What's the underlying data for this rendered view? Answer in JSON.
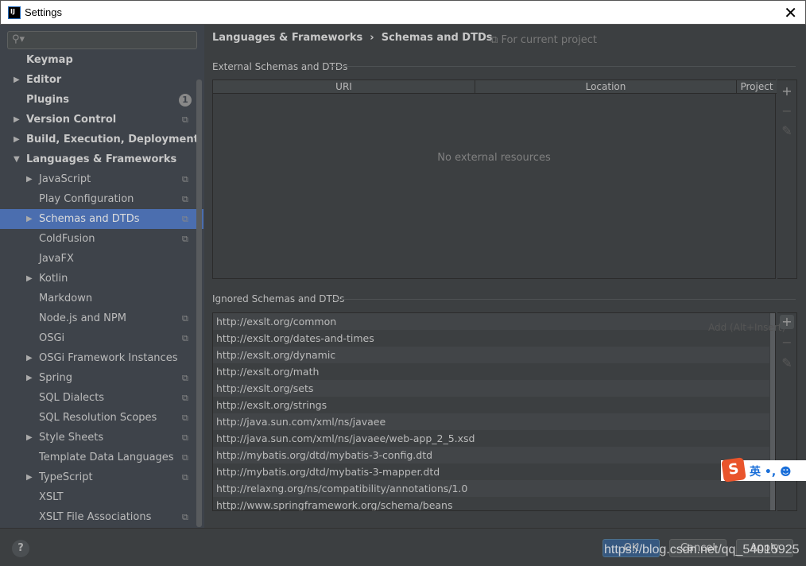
{
  "window": {
    "title": "Settings",
    "logo": "IJ"
  },
  "sidebar": {
    "search_placeholder": "",
    "items": [
      {
        "label": "Keymap",
        "level": 0,
        "bold": true,
        "arrow": false
      },
      {
        "label": "Editor",
        "level": 0,
        "bold": true,
        "arrow": "right"
      },
      {
        "label": "Plugins",
        "level": 0,
        "bold": true,
        "arrow": false,
        "badge": "1"
      },
      {
        "label": "Version Control",
        "level": 0,
        "bold": true,
        "arrow": "right",
        "copy": true
      },
      {
        "label": "Build, Execution, Deployment",
        "level": 0,
        "bold": true,
        "arrow": "right"
      },
      {
        "label": "Languages & Frameworks",
        "level": 0,
        "bold": true,
        "arrow": "down"
      },
      {
        "label": "JavaScript",
        "level": 1,
        "arrow": "right",
        "copy": true
      },
      {
        "label": "Play Configuration",
        "level": 1,
        "copy": true
      },
      {
        "label": "Schemas and DTDs",
        "level": 1,
        "arrow": "right",
        "copy": true,
        "selected": true
      },
      {
        "label": "ColdFusion",
        "level": 1,
        "copy": true
      },
      {
        "label": "JavaFX",
        "level": 1
      },
      {
        "label": "Kotlin",
        "level": 1,
        "arrow": "right"
      },
      {
        "label": "Markdown",
        "level": 1
      },
      {
        "label": "Node.js and NPM",
        "level": 1,
        "copy": true
      },
      {
        "label": "OSGi",
        "level": 1,
        "copy": true
      },
      {
        "label": "OSGi Framework Instances",
        "level": 1,
        "arrow": "right"
      },
      {
        "label": "Spring",
        "level": 1,
        "arrow": "right",
        "copy": true
      },
      {
        "label": "SQL Dialects",
        "level": 1,
        "copy": true
      },
      {
        "label": "SQL Resolution Scopes",
        "level": 1,
        "copy": true
      },
      {
        "label": "Style Sheets",
        "level": 1,
        "arrow": "right",
        "copy": true
      },
      {
        "label": "Template Data Languages",
        "level": 1,
        "copy": true
      },
      {
        "label": "TypeScript",
        "level": 1,
        "arrow": "right",
        "copy": true
      },
      {
        "label": "XSLT",
        "level": 1
      },
      {
        "label": "XSLT File Associations",
        "level": 1,
        "copy": true
      }
    ]
  },
  "main": {
    "breadcrumb": [
      "Languages & Frameworks",
      "Schemas and DTDs"
    ],
    "scope": "For current project",
    "external": {
      "title": "External Schemas and DTDs",
      "columns": [
        "URI",
        "Location",
        "Project"
      ],
      "empty_text": "No external resources"
    },
    "ignored": {
      "title": "Ignored Schemas and DTDs",
      "tooltip": "Add (Alt+Insert)",
      "items": [
        "http://exslt.org/common",
        "http://exslt.org/dates-and-times",
        "http://exslt.org/dynamic",
        "http://exslt.org/math",
        "http://exslt.org/sets",
        "http://exslt.org/strings",
        "http://java.sun.com/xml/ns/javaee",
        "http://java.sun.com/xml/ns/javaee/web-app_2_5.xsd",
        "http://mybatis.org/dtd/mybatis-3-config.dtd",
        "http://mybatis.org/dtd/mybatis-3-mapper.dtd",
        "http://relaxng.org/ns/compatibility/annotations/1.0",
        "http://www.springframework.org/schema/beans"
      ]
    }
  },
  "footer": {
    "help": "?",
    "ok": "OK",
    "cancel": "Cancel",
    "apply": "Apply"
  },
  "overlay": {
    "watermark": "https://blog.csdn.net/qq_54015925",
    "ime_logo": "S",
    "ime_text": "英 •, ☻"
  },
  "colors": {
    "selection": "#4b6eaf",
    "ok_button": "#365880"
  }
}
